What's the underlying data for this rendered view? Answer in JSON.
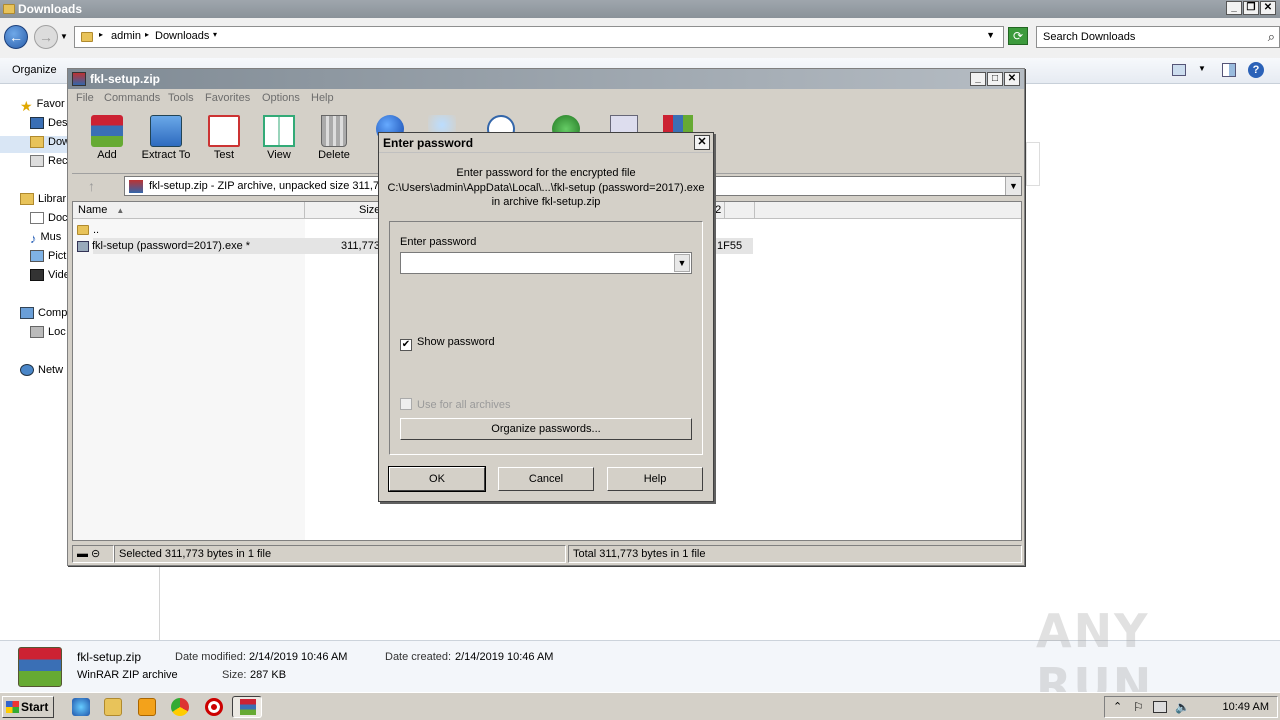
{
  "explorer": {
    "title": "Downloads",
    "breadcrumb": [
      "admin",
      "Downloads"
    ],
    "search_placeholder": "Search Downloads",
    "organize": "Organize",
    "nav": [
      {
        "label": "Favor",
        "icon": "star-icon"
      },
      {
        "label": "Des",
        "icon": "desktop-icon"
      },
      {
        "label": "Dow",
        "icon": "downloads-folder-icon"
      },
      {
        "label": "Rec",
        "icon": "recent-places-icon"
      },
      {
        "label": "Librar",
        "icon": "libraries-icon"
      },
      {
        "label": "Doc",
        "icon": "documents-icon"
      },
      {
        "label": "Mus",
        "icon": "music-icon"
      },
      {
        "label": "Pict",
        "icon": "pictures-icon"
      },
      {
        "label": "Vide",
        "icon": "videos-icon"
      },
      {
        "label": "Comp",
        "icon": "computer-icon"
      },
      {
        "label": "Loc",
        "icon": "local-disk-icon"
      },
      {
        "label": "Netw",
        "icon": "network-icon"
      }
    ],
    "details": {
      "file_name": "fkl-setup.zip",
      "file_type": "WinRAR ZIP archive",
      "date_modified_label": "Date modified:",
      "date_modified": "2/14/2019 10:46 AM",
      "date_created_label": "Date created:",
      "date_created": "2/14/2019 10:46 AM",
      "size_label": "Size:",
      "size": "287 KB"
    }
  },
  "winrar": {
    "title": "fkl-setup.zip",
    "menu": [
      "File",
      "Commands",
      "Tools",
      "Favorites",
      "Options",
      "Help"
    ],
    "toolbar": [
      "Add",
      "Extract To",
      "Test",
      "View",
      "Delete"
    ],
    "path": "fkl-setup.zip - ZIP archive, unpacked size 311,773 bytes",
    "columns": {
      "name": "Name",
      "size": "Size",
      "crc_partial": "32"
    },
    "rows": [
      {
        "name": "..",
        "size": "",
        "crc": ""
      },
      {
        "name": "fkl-setup (password=2017).exe *",
        "size": "311,773",
        "crc": "1F55"
      }
    ],
    "status_left": "Selected 311,773 bytes in 1 file",
    "status_right": "Total 311,773 bytes in 1 file"
  },
  "dialog": {
    "title": "Enter password",
    "message_line1": "Enter password for the encrypted file",
    "message_line2": "C:\\Users\\admin\\AppData\\Local\\...\\fkl-setup (password=2017).exe",
    "message_line3": "in archive fkl-setup.zip",
    "field_label": "Enter password",
    "field_value": "",
    "show_password": "Show password",
    "show_password_checked": true,
    "use_for_all": "Use for all archives",
    "use_for_all_checked": false,
    "organize_button": "Organize passwords...",
    "ok": "OK",
    "cancel": "Cancel",
    "help": "Help"
  },
  "taskbar": {
    "start": "Start",
    "clock": "10:49 AM"
  },
  "watermark": "ANY RUN"
}
